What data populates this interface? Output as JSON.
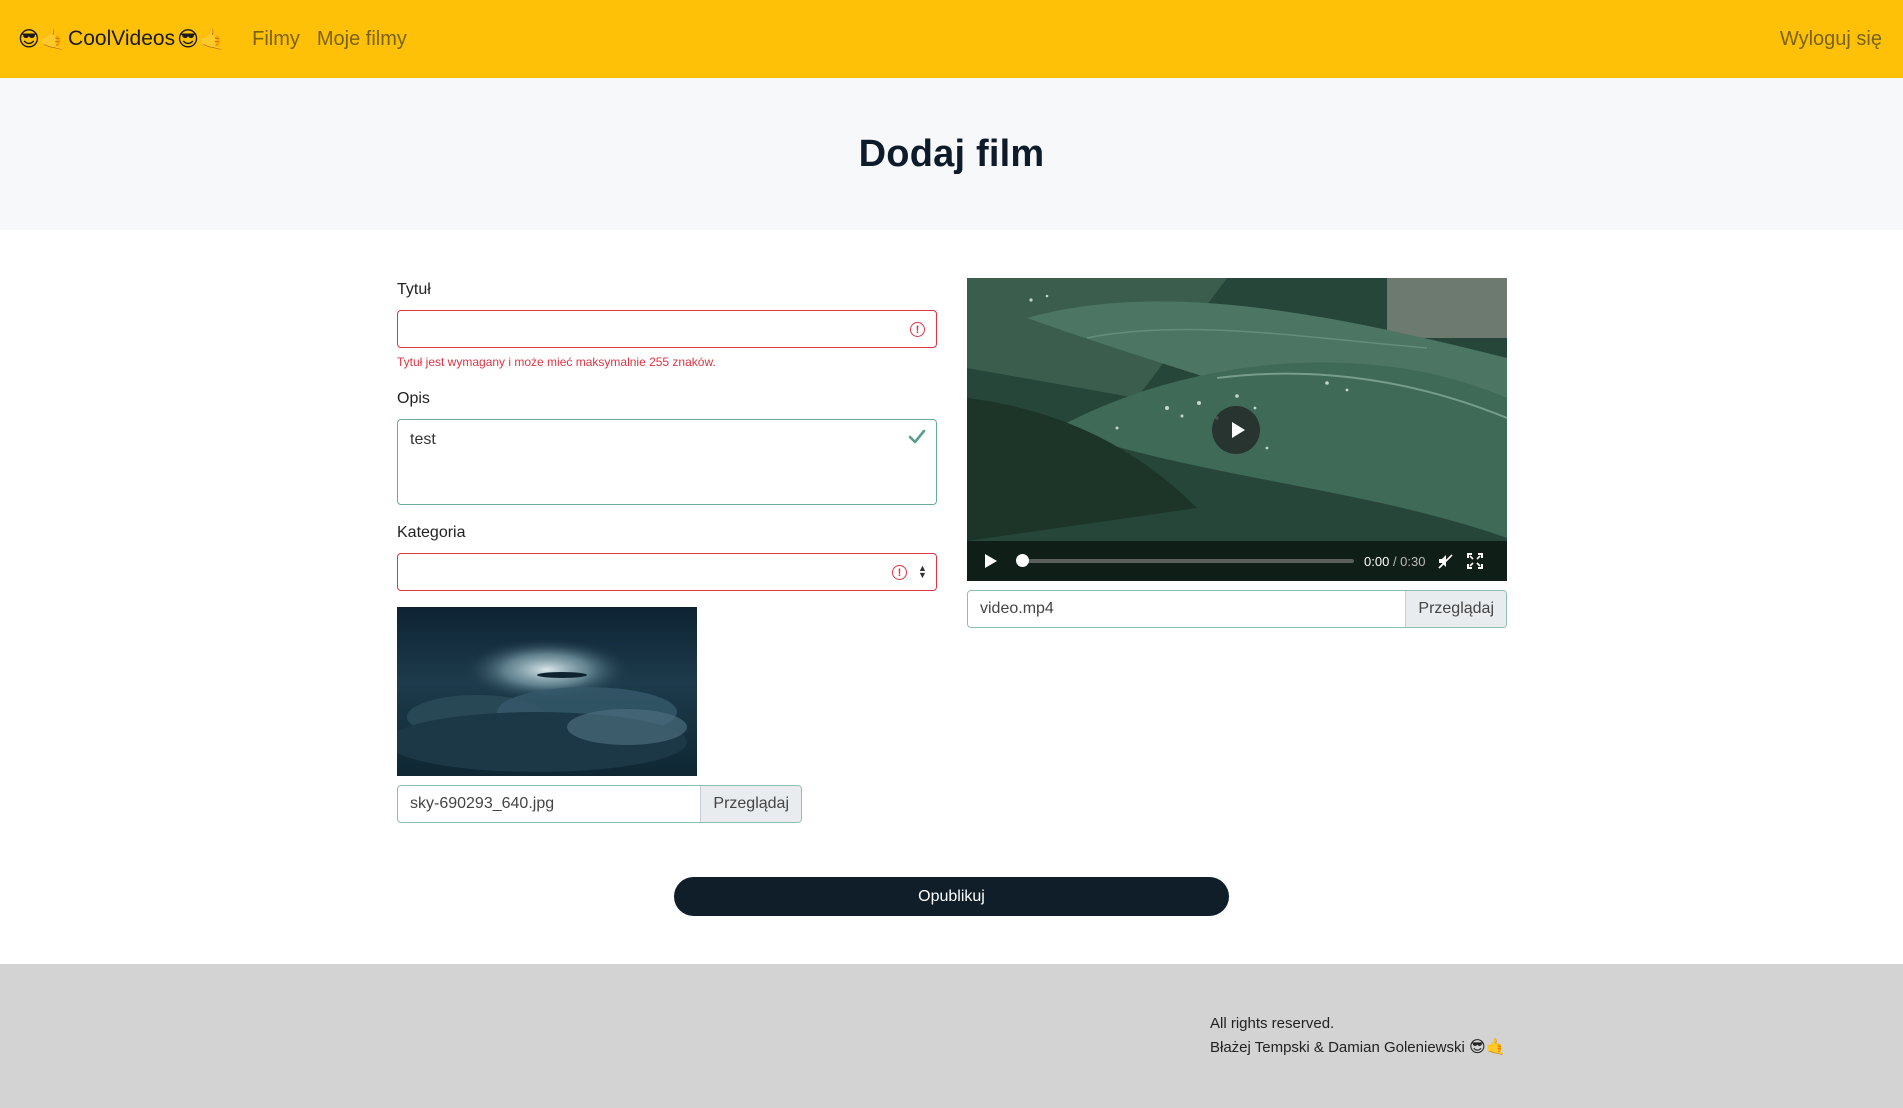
{
  "navbar": {
    "brand_prefix": "😎🤙",
    "brand_name": "CoolVideos",
    "brand_suffix": "😎🤙",
    "links": [
      "Filmy",
      "Moje filmy"
    ],
    "logout": "Wyloguj się"
  },
  "page": {
    "title": "Dodaj film"
  },
  "form": {
    "title": {
      "label": "Tytuł",
      "value": "",
      "error": "Tytuł jest wymagany i może mieć maksymalnie 255 znaków."
    },
    "description": {
      "label": "Opis",
      "value": "test"
    },
    "category": {
      "label": "Kategoria",
      "value": ""
    },
    "thumbnail": {
      "file_name": "sky-690293_640.jpg",
      "browse_label": "Przeglądaj"
    },
    "video": {
      "file_name": "video.mp4",
      "browse_label": "Przeglądaj",
      "current_time": "0:00",
      "total_time": "/ 0:30",
      "progress": 0
    },
    "submit_label": "Opublikuj"
  },
  "footer": {
    "rights": "All rights reserved.",
    "authors": "Błażej Tempski & Damian Goleniewski",
    "authors_emoji": "😎🤙"
  },
  "colors": {
    "navbar": "#ffc107",
    "invalid": "#dc3545",
    "valid": "#6aaa9a",
    "button": "#0f1e29",
    "footer": "#d3d3d3"
  }
}
